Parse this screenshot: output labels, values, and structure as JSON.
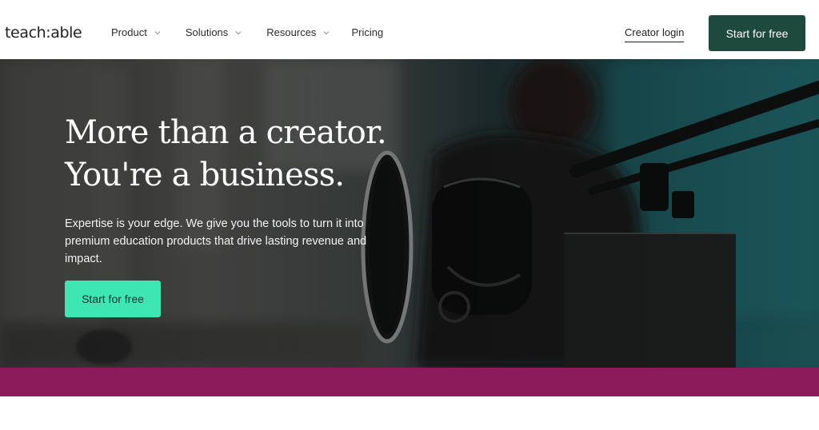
{
  "header": {
    "logo_text": "teach:able",
    "nav": [
      {
        "label": "Product",
        "has_dropdown": true
      },
      {
        "label": "Solutions",
        "has_dropdown": true
      },
      {
        "label": "Resources",
        "has_dropdown": true
      },
      {
        "label": "Pricing",
        "has_dropdown": false
      }
    ],
    "login_label": "Creator login",
    "cta_label": "Start for free"
  },
  "hero": {
    "headline_line1": "More than a creator.",
    "headline_line2": "You're a business.",
    "subtext": "Expertise is your edge. We give you the tools to turn it into premium education products that drive lasting revenue and impact.",
    "cta_label": "Start for free",
    "background_image": "podcaster-with-microphone-photo"
  },
  "colors": {
    "header_cta_bg": "#1e4a3e",
    "hero_cta_bg": "#3ee6b3",
    "band_bg": "#8c1b5c"
  }
}
